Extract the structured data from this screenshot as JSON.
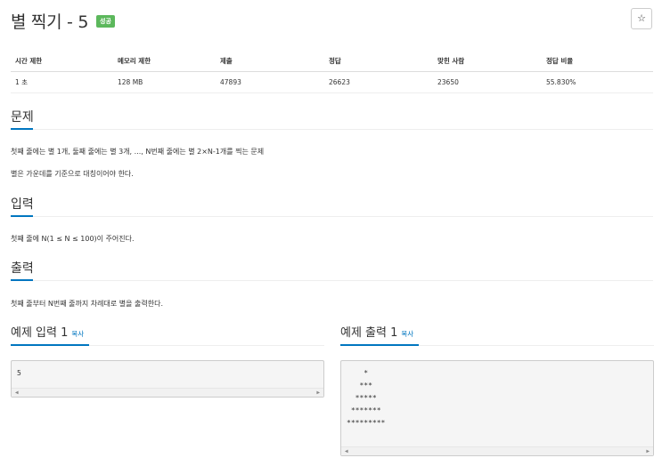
{
  "problem": {
    "title": "별 찍기 - 5",
    "badge": "성공",
    "star": "☆"
  },
  "info_table": {
    "headers": [
      "시간 제한",
      "메모리 제한",
      "제출",
      "정답",
      "맞힌 사람",
      "정답 비율"
    ],
    "values": [
      "1 초",
      "128 MB",
      "47893",
      "26623",
      "23650",
      "55.830%"
    ]
  },
  "sections": {
    "problem": {
      "title": "문제",
      "lines": [
        "첫째 줄에는 별 1개, 둘째 줄에는 별 3개, ..., N번째 줄에는 별 2×N-1개를 찍는 문제",
        "별은 가운데를 기준으로 대칭이어야 한다."
      ]
    },
    "input": {
      "title": "입력",
      "lines": [
        "첫째 줄에 N(1 ≤ N ≤ 100)이 주어진다."
      ]
    },
    "output": {
      "title": "출력",
      "lines": [
        "첫째 줄부터 N번째 줄까지 차례대로 별을 출력한다."
      ]
    }
  },
  "samples": {
    "input": {
      "title": "예제 입력 1",
      "copy": "복사",
      "text": "5"
    },
    "output": {
      "title": "예제 출력 1",
      "copy": "복사",
      "text": "    *\n   ***\n  *****\n *******\n*********"
    }
  },
  "scroll": {
    "left": "◀",
    "right": "▶"
  }
}
